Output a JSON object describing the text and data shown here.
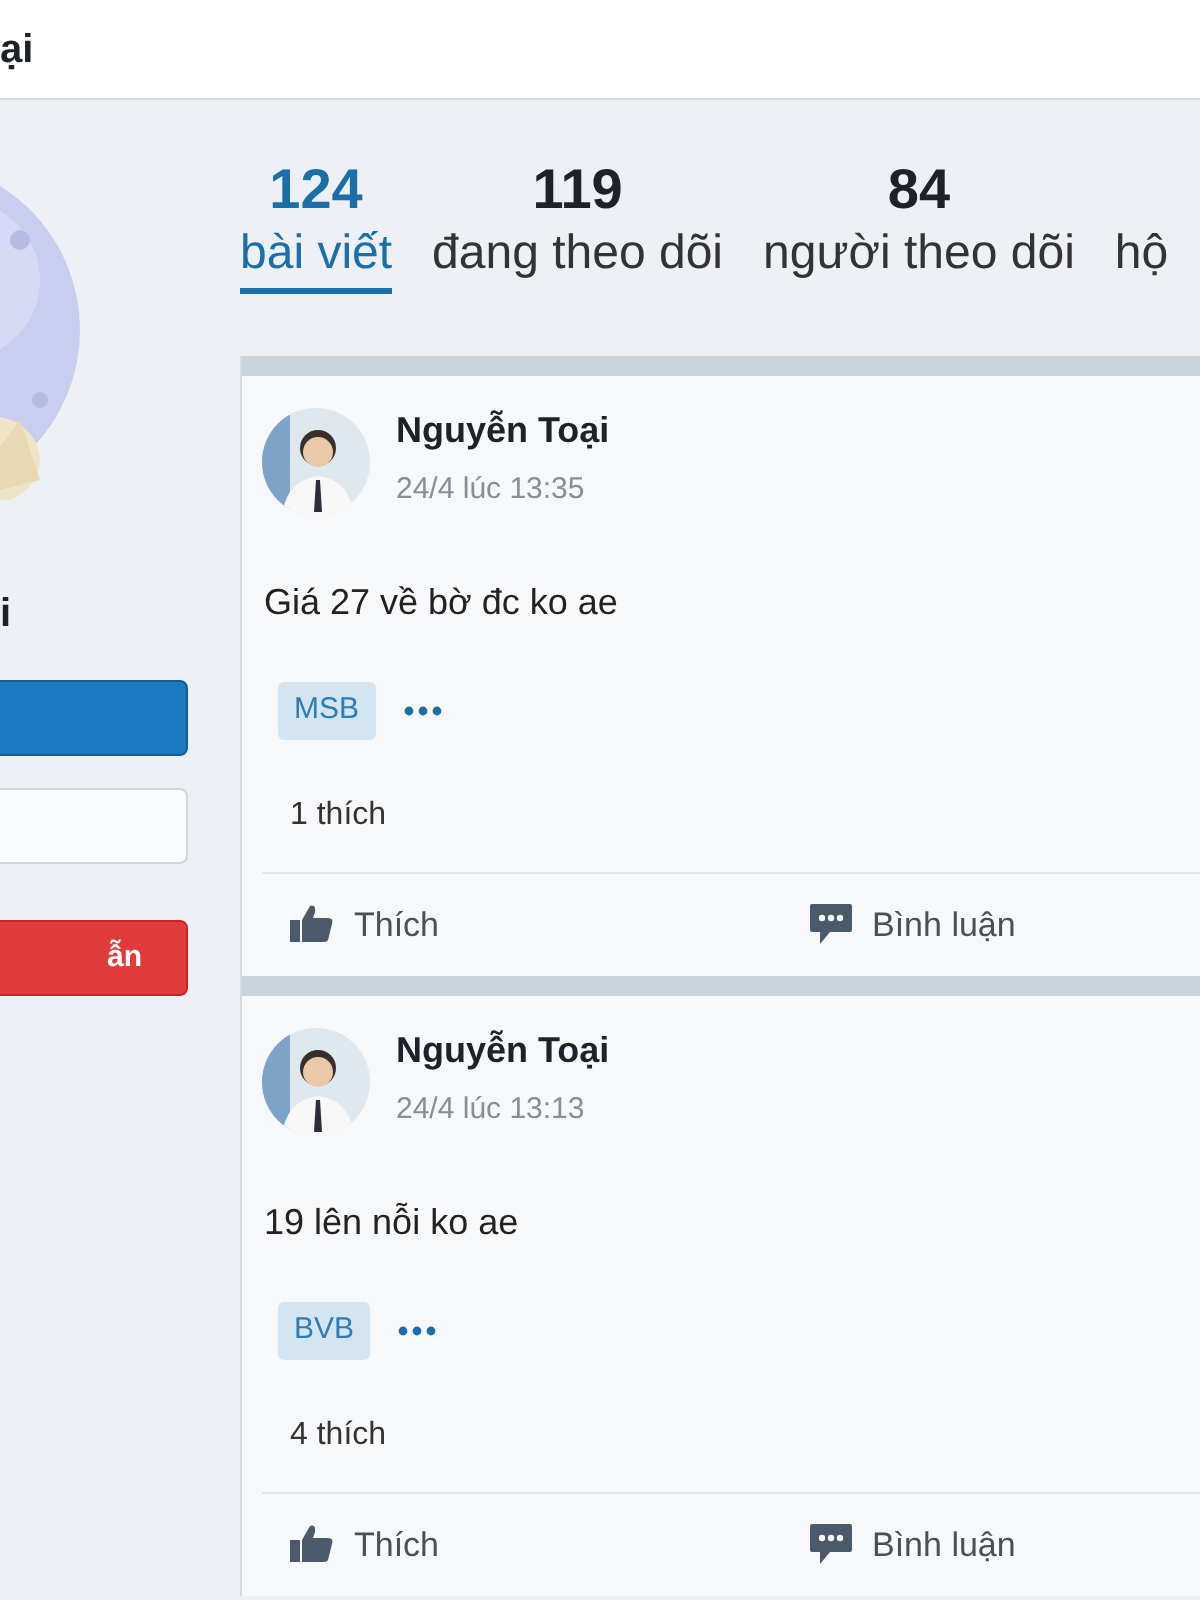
{
  "header": {
    "title": "ại"
  },
  "profile": {
    "name": "i",
    "buttons": [
      {
        "kind": "primary"
      },
      {
        "kind": "outline"
      },
      {
        "kind": "danger",
        "label": "ẫn"
      }
    ]
  },
  "stats": [
    {
      "count": "124",
      "label": "bài viết",
      "selected": true
    },
    {
      "count": "119",
      "label": "đang theo dõi",
      "selected": false
    },
    {
      "count": "84",
      "label": "người theo dõi",
      "selected": false
    },
    {
      "label": "hộ",
      "selected": false
    }
  ],
  "posts": [
    {
      "author": "Nguyễn Toại",
      "time": "24/4 lúc 13:35",
      "text": "Giá 27 về bờ đc ko ae",
      "tag": "MSB",
      "likes": "1 thích",
      "actions": [
        "Thích",
        "Bình luận"
      ]
    },
    {
      "author": "Nguyễn Toại",
      "time": "24/4 lúc 13:13",
      "text": "19 lên nỗi ko ae",
      "tag": "BVB",
      "likes": "4 thích",
      "actions": [
        "Thích",
        "Bình luận"
      ]
    }
  ]
}
